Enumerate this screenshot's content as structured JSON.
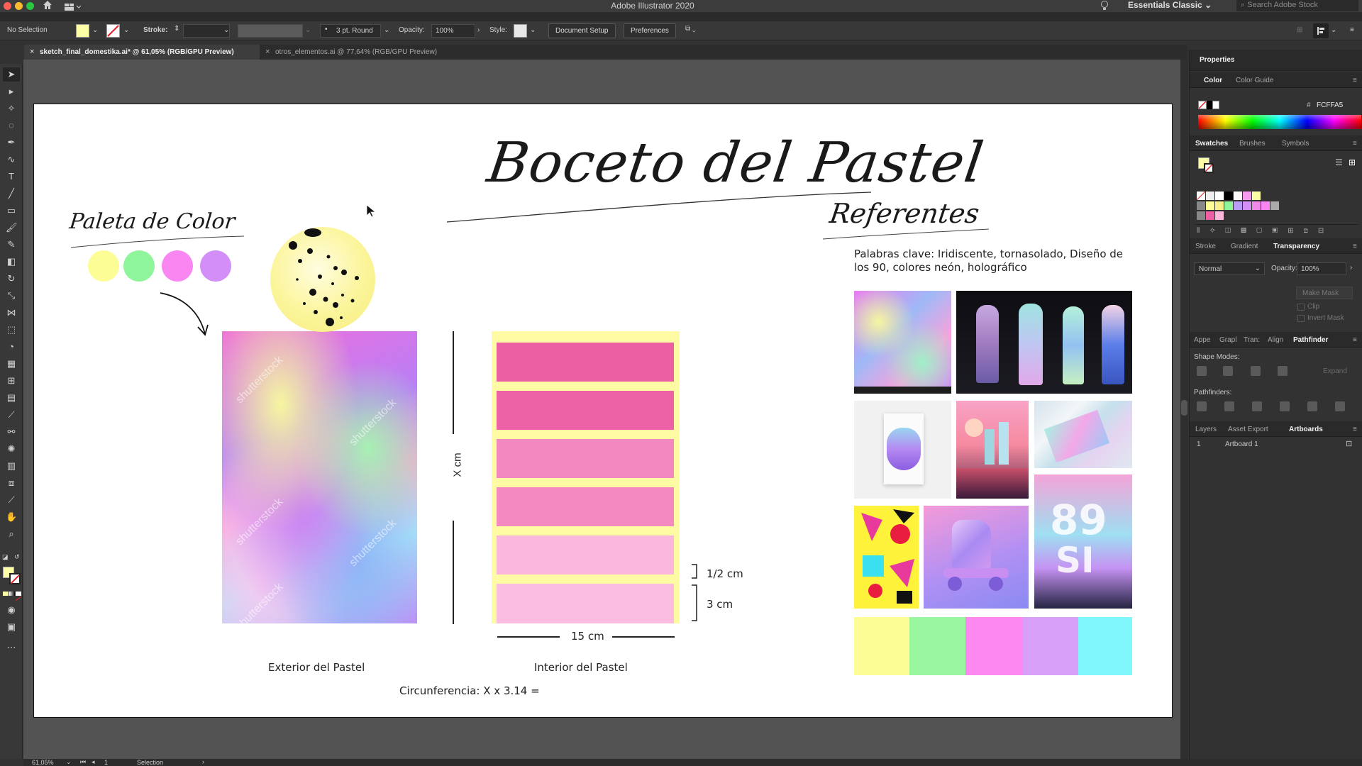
{
  "window": {
    "title": "Adobe Illustrator 2020",
    "workspace": "Essentials Classic",
    "stock_search_placeholder": "Search Adobe Stock"
  },
  "control_bar": {
    "selection_label": "No Selection",
    "stroke_label": "Stroke:",
    "brush_value": "3 pt. Round",
    "opacity_label": "Opacity:",
    "opacity_value": "100%",
    "style_label": "Style:",
    "document_setup": "Document Setup",
    "preferences": "Preferences"
  },
  "tabs": [
    {
      "label": "sketch_final_domestika.ai* @ 61,05% (RGB/GPU Preview)",
      "active": true
    },
    {
      "label": "otros_elementos.ai @ 77,64% (RGB/GPU Preview)",
      "active": false
    }
  ],
  "panel": {
    "title": "Properties",
    "color_tabs": [
      "Color",
      "Color Guide"
    ],
    "hex_value": "FCFFA5",
    "swatch_tabs": [
      "Swatches",
      "Brushes",
      "Symbols"
    ],
    "stroke_tabs": [
      "Stroke",
      "Gradient",
      "Transparency"
    ],
    "blend_mode": "Normal",
    "opacity_label": "Opacity:",
    "opacity_value": "100%",
    "make_mask": "Make Mask",
    "clip": "Clip",
    "invert_mask": "Invert Mask",
    "align_tabs": [
      "Appe",
      "Grapl",
      "Tran:",
      "Align",
      "Pathfinder"
    ],
    "shape_modes": "Shape Modes:",
    "expand": "Expand",
    "pathfinders": "Pathfinders:",
    "layer_tabs": [
      "Layers",
      "Asset Export",
      "Artboards"
    ],
    "artboard_index": "1",
    "artboard_name": "Artboard 1"
  },
  "status_bar": {
    "zoom": "61,05%",
    "artboard": "1",
    "tool": "Selection"
  },
  "artboard_content": {
    "main_title": "Boceto del Pastel",
    "palette_title": "Paleta de Color",
    "references_title": "Referentes",
    "keywords": "Palabras clave: Iridiscente, tornasolado, Diseño de los 90, colores neón, holográfico",
    "exterior_label": "Exterior del Pastel",
    "interior_label": "Interior del Pastel",
    "circumference": "Circunferencia: X x 3.14 =",
    "height_label": "X cm",
    "half_cm": "1/2 cm",
    "three_cm": "3 cm",
    "width_label": "15 cm",
    "watermark": "shutterstock"
  },
  "colors": {
    "palette": [
      "#fdfd96",
      "#8ff59a",
      "#fa86f2",
      "#d48ef8"
    ],
    "strip": [
      "#fdfd96",
      "#9bf6a0",
      "#fc88f0",
      "#d79ff8",
      "#7ff7fb"
    ],
    "layers": [
      "#ec5fa2",
      "#ed62a6",
      "#f387bf",
      "#f488c0",
      "#fbb8dc",
      "#fbbde0"
    ],
    "frame": "#fffba5",
    "accent": "#31a8ff",
    "fill_swatch": "#fcffa5"
  }
}
